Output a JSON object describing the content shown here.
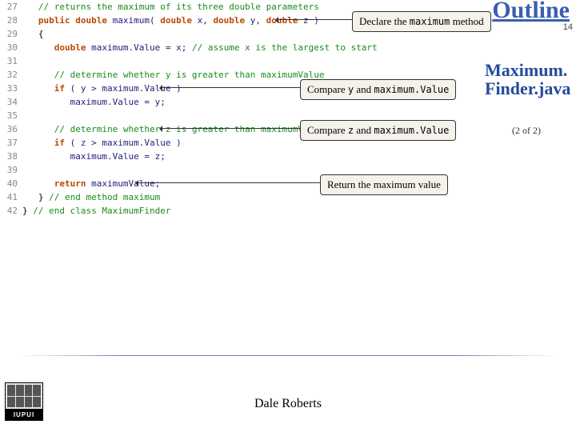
{
  "slide": {
    "outline_label": "Outline",
    "number": "14",
    "filename": "Maximum.Finder.java",
    "filesub": "(2 of 2)",
    "footer_author": "Dale Roberts",
    "logo_text": "IUPUI"
  },
  "callouts": {
    "declare_pre": "Declare the ",
    "declare_mono": "maximum",
    "declare_post": " method",
    "compare_y_pre": "Compare ",
    "compare_y_mono1": "y",
    "compare_y_mid": " and ",
    "compare_y_mono2": "maximum.Value",
    "compare_z_pre": "Compare ",
    "compare_z_mono1": "z",
    "compare_z_mid": " and ",
    "compare_z_mono2": "maximum.Value",
    "return_text": "Return the maximum value"
  },
  "code": {
    "l27": "// returns the maximum of its three double parameters",
    "l28a": "public double ",
    "l28b": "maximum( ",
    "l28c": "double ",
    "l28d": "x, ",
    "l28e": "double ",
    "l28f": "y, ",
    "l28g": "double ",
    "l28h": "z )",
    "l29": "{",
    "l30a": "double ",
    "l30b": "maximum.Value = x; ",
    "l30c": "// assume x is the largest to start",
    "l32": "// determine whether y is greater than maximumValue",
    "l33a": "if ",
    "l33b": "( y > maximum.Value )",
    "l34": "maximum.Value = y;",
    "l36": "// determine whether z is greater than maximumValue",
    "l37a": "if ",
    "l37b": "( z > maximum.Value )",
    "l38": "maximum.Value = z;",
    "l40a": "return ",
    "l40b": "maximumValue;",
    "l41a": "} ",
    "l41b": "// end method maximum",
    "l42a": "} ",
    "l42b": "// end class MaximumFinder",
    "n27": "27",
    "n28": "28",
    "n29": "29",
    "n30": "30",
    "n31": "31",
    "n32": "32",
    "n33": "33",
    "n34": "34",
    "n35": "35",
    "n36": "36",
    "n37": "37",
    "n38": "38",
    "n39": "39",
    "n40": "40",
    "n41": "41",
    "n42": "42"
  }
}
